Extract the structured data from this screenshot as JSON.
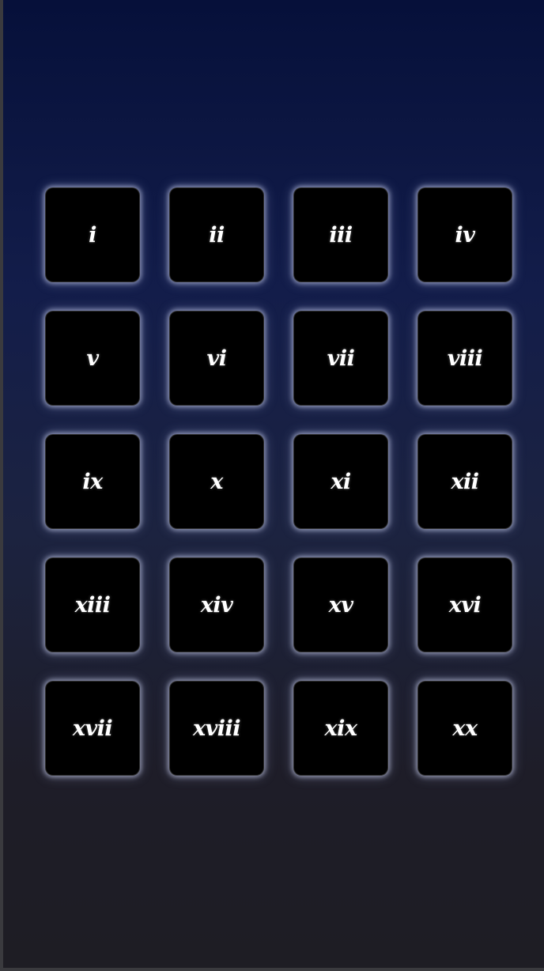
{
  "tiles": [
    {
      "label": "i"
    },
    {
      "label": "ii"
    },
    {
      "label": "iii"
    },
    {
      "label": "iv"
    },
    {
      "label": "v"
    },
    {
      "label": "vi"
    },
    {
      "label": "vii"
    },
    {
      "label": "viii"
    },
    {
      "label": "ix"
    },
    {
      "label": "x"
    },
    {
      "label": "xi"
    },
    {
      "label": "xii"
    },
    {
      "label": "xiii"
    },
    {
      "label": "xiv"
    },
    {
      "label": "xv"
    },
    {
      "label": "xvi"
    },
    {
      "label": "xvii"
    },
    {
      "label": "xviii"
    },
    {
      "label": "xix"
    },
    {
      "label": "xx"
    }
  ],
  "colors": {
    "tile_background": "#000000",
    "tile_glow": "#d2d7f5",
    "background_top": "#06103a",
    "background_bottom": "#1e1d24"
  }
}
